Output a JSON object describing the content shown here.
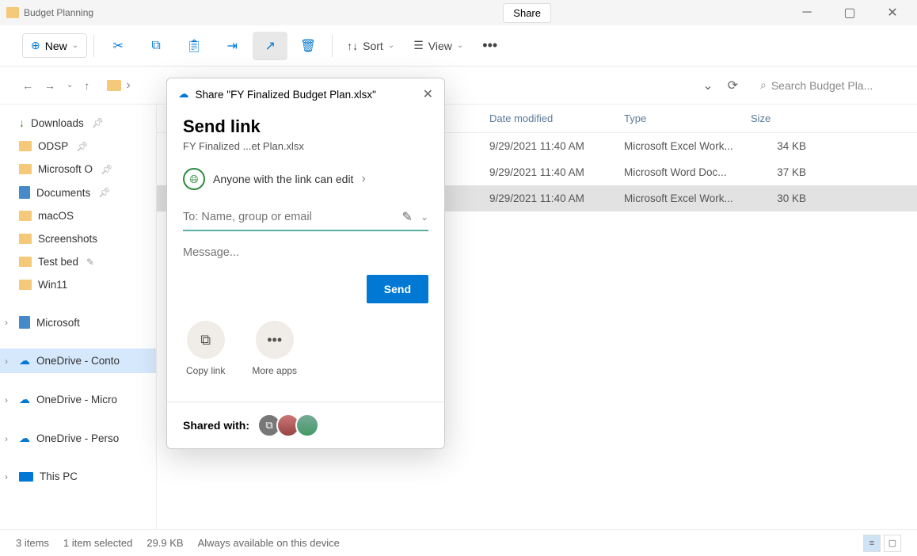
{
  "titlebar": {
    "title": "Budget Planning",
    "share_tab": "Share"
  },
  "toolbar": {
    "new_label": "New",
    "sort_label": "Sort",
    "view_label": "View"
  },
  "nav": {
    "search_placeholder": "Search Budget Pla..."
  },
  "sidebar": {
    "items": [
      {
        "label": "Downloads",
        "icon": "download",
        "pinned": true
      },
      {
        "label": "ODSP",
        "icon": "folder",
        "pinned": true
      },
      {
        "label": "Microsoft O",
        "icon": "folder",
        "pinned": true
      },
      {
        "label": "Documents",
        "icon": "doc",
        "pinned": true
      },
      {
        "label": "macOS",
        "icon": "folder"
      },
      {
        "label": "Screenshots",
        "icon": "folder"
      },
      {
        "label": "Test bed",
        "icon": "folder",
        "edit": true
      },
      {
        "label": "Win11",
        "icon": "folder"
      }
    ],
    "groups": [
      {
        "label": "Microsoft",
        "icon": "doc"
      },
      {
        "label": "OneDrive - Conto",
        "icon": "cloud",
        "selected": true
      },
      {
        "label": "OneDrive - Micro",
        "icon": "cloud"
      },
      {
        "label": "OneDrive - Perso",
        "icon": "cloud"
      },
      {
        "label": "This PC",
        "icon": "pc"
      }
    ]
  },
  "columns": {
    "name": "",
    "date": "Date modified",
    "type": "Type",
    "size": "Size"
  },
  "files": [
    {
      "date": "9/29/2021 11:40 AM",
      "type": "Microsoft Excel Work...",
      "size": "34 KB"
    },
    {
      "date": "9/29/2021 11:40 AM",
      "type": "Microsoft Word Doc...",
      "size": "37 KB"
    },
    {
      "date": "9/29/2021 11:40 AM",
      "type": "Microsoft Excel Work...",
      "size": "30 KB",
      "selected": true
    }
  ],
  "status": {
    "items": "3 items",
    "selected": "1 item selected",
    "size": "29.9 KB",
    "avail": "Always available on this device"
  },
  "dialog": {
    "title": "Share \"FY Finalized Budget Plan.xlsx\"",
    "heading": "Send link",
    "subheading": "FY Finalized ...et Plan.xlsx",
    "permission": "Anyone with the link can edit",
    "to_placeholder": "To: Name, group or email",
    "message_placeholder": "Message...",
    "send_label": "Send",
    "copy_link_label": "Copy link",
    "more_apps_label": "More apps",
    "shared_with_label": "Shared with:"
  }
}
